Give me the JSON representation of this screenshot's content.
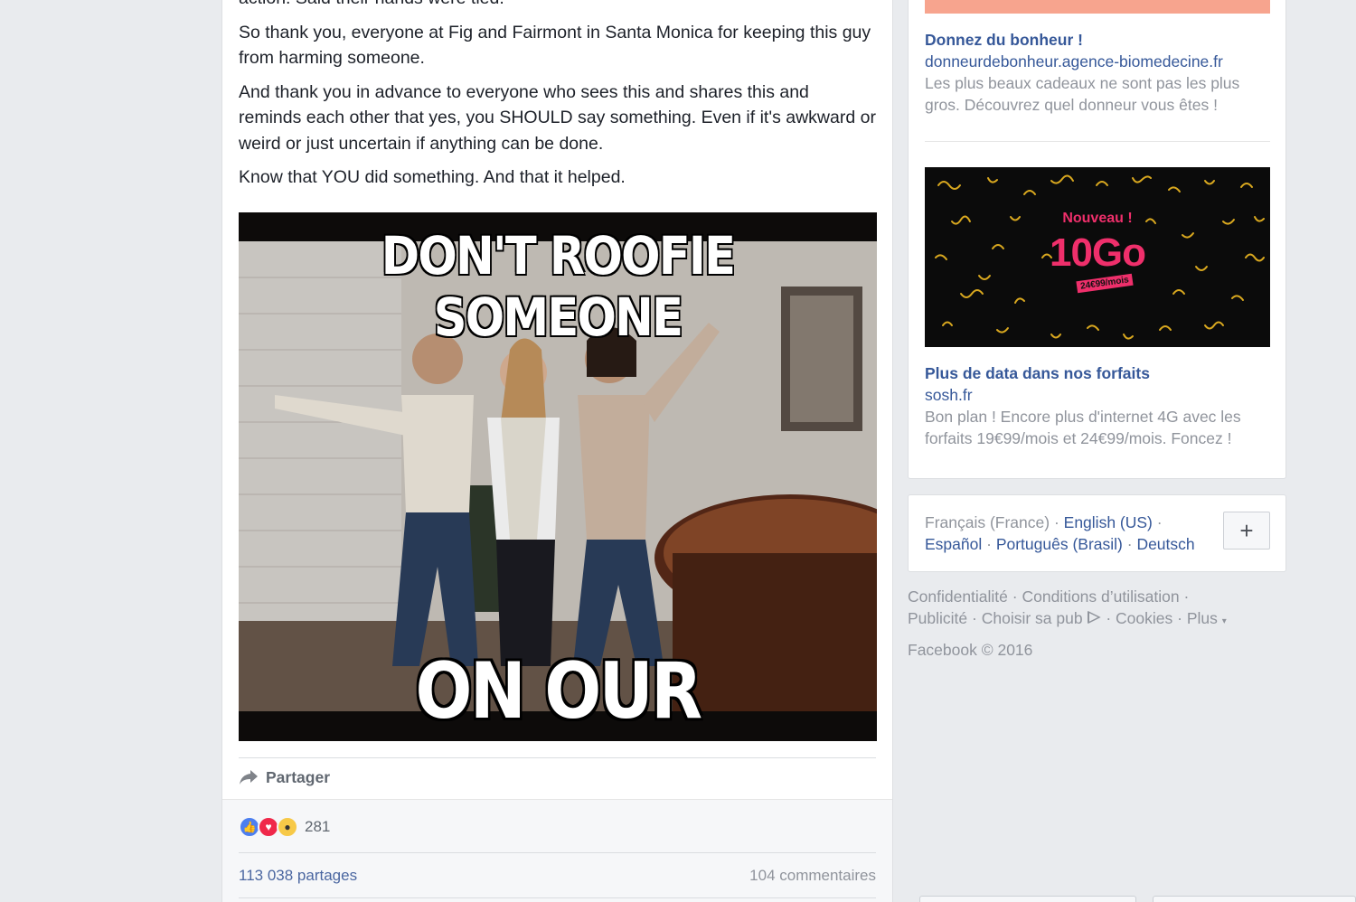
{
  "post": {
    "paragraphs": [
      "action. Said their hands were tied.",
      "So thank you, everyone at Fig and Fairmont in Santa Monica for keeping this guy from harming someone.",
      "And thank you in advance to everyone who sees this and shares this and reminds each other that yes, you SHOULD say something. Even if it's awkward or weird or just uncertain if anything can be done.",
      "Know that YOU did something. And that it helped."
    ],
    "meme_top_text": "DON'T ROOFIE SOMEONE",
    "meme_bottom_text": "ON OUR WATCH!",
    "share_label": "Partager",
    "reaction_count": "281",
    "shares_count": "113 038 partages",
    "comments_count": "104 commentaires",
    "reaction_icons": [
      "like-icon",
      "love-icon",
      "wow-icon"
    ]
  },
  "ads": [
    {
      "title": "Donnez du bonheur !",
      "domain": "donneurdebonheur.agence-biomedecine.fr",
      "description": "Les plus beaux cadeaux ne sont pas les plus gros. Découvrez quel donneur vous êtes !",
      "banner_color": "#f7a48e"
    },
    {
      "title": "Plus de data dans nos forfaits",
      "domain": "sosh.fr",
      "description": "Bon plan ! Encore plus d'internet 4G avec les forfaits 19€99/mois et 24€99/mois. Foncez !",
      "image_nouveau": "Nouveau !",
      "image_headline": "10Go",
      "image_price": "24€99/mois",
      "accent_color": "#ef2f6b"
    }
  ],
  "languages": {
    "current": "Français (France)",
    "links": [
      "English (US)",
      "Español",
      "Português (Brasil)",
      "Deutsch"
    ],
    "add_button": "+"
  },
  "legal": {
    "links": [
      "Confidentialité",
      "Conditions d’utilisation",
      "Publicité",
      "Choisir sa pub",
      "Cookies",
      "Plus"
    ],
    "copyright": "Facebook © 2016"
  },
  "colors": {
    "link": "#365899",
    "muted": "#90949c",
    "page_bg": "#e9ebee"
  }
}
